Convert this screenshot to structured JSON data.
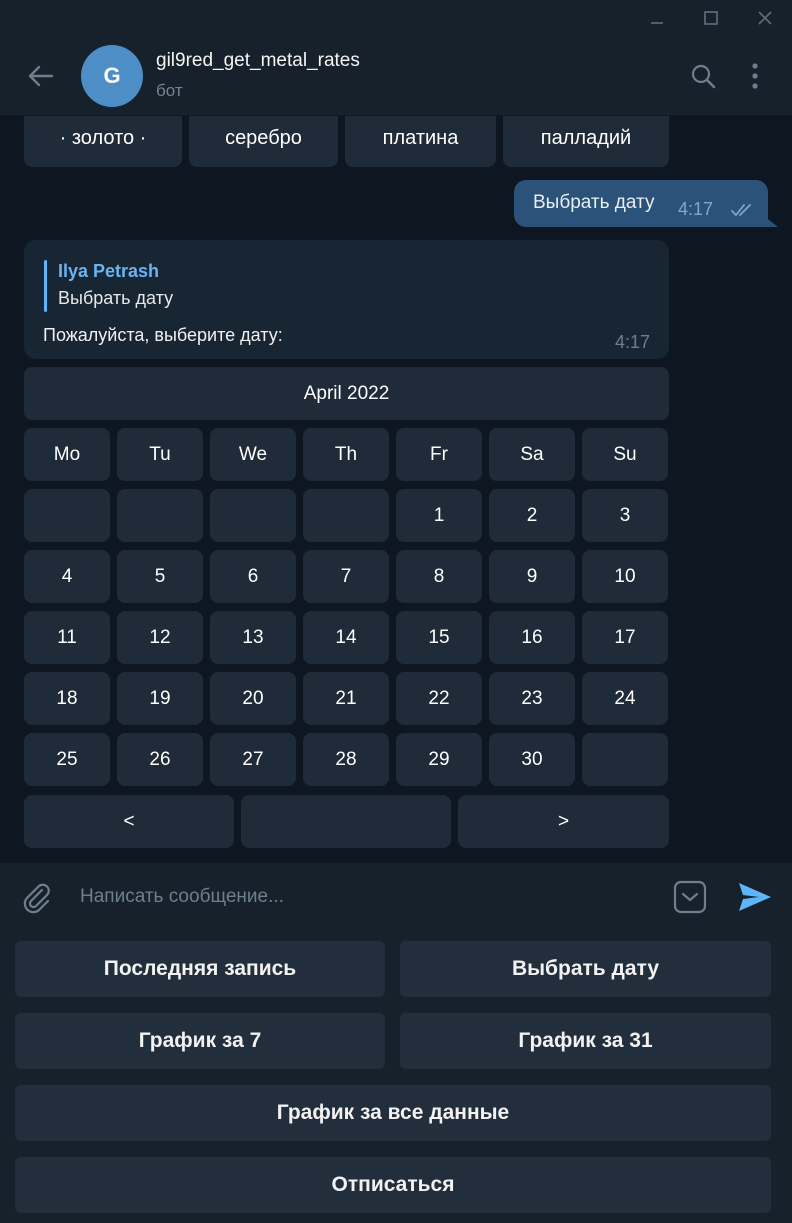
{
  "chat": {
    "avatar_letter": "G",
    "name": "gil9red_get_metal_rates",
    "status": "бот"
  },
  "metals": [
    "· золото ·",
    "серебро",
    "платина",
    "палладий"
  ],
  "outgoing": {
    "text": "Выбрать дату",
    "time": "4:17"
  },
  "incoming": {
    "reply_author": "Ilya Petrash",
    "reply_text": "Выбрать дату",
    "text": "Пожалуйста, выберите дату:",
    "time": "4:17"
  },
  "calendar": {
    "month": "April 2022",
    "weekdays": [
      "Mo",
      "Tu",
      "We",
      "Th",
      "Fr",
      "Sa",
      "Su"
    ],
    "weeks": [
      [
        "",
        "",
        "",
        "",
        "1",
        "2",
        "3"
      ],
      [
        "4",
        "5",
        "6",
        "7",
        "8",
        "9",
        "10"
      ],
      [
        "11",
        "12",
        "13",
        "14",
        "15",
        "16",
        "17"
      ],
      [
        "18",
        "19",
        "20",
        "21",
        "22",
        "23",
        "24"
      ],
      [
        "25",
        "26",
        "27",
        "28",
        "29",
        "30",
        ""
      ]
    ],
    "nav": {
      "prev": "<",
      "middle": "",
      "next": ">"
    }
  },
  "input": {
    "placeholder": "Написать сообщение..."
  },
  "reply_keyboard": {
    "last_record": "Последняя запись",
    "choose_date": "Выбрать дату",
    "chart_7": "График за 7",
    "chart_31": "График за 31",
    "chart_all": "График за все данные",
    "unsubscribe": "Отписаться"
  },
  "colors": {
    "background": "#0e1621",
    "panel": "#17212b",
    "accent": "#5eb5f7",
    "outgoing_bubble": "#2b5278",
    "incoming_bubble": "#182533",
    "inline_button": "#1f2b38",
    "avatar": "#4d8ec7"
  },
  "icons": [
    "minimize-icon",
    "maximize-icon",
    "close-icon",
    "back-arrow-icon",
    "search-icon",
    "more-vertical-icon",
    "double-check-icon",
    "paperclip-icon",
    "keyboard-toggle-icon",
    "send-icon"
  ]
}
